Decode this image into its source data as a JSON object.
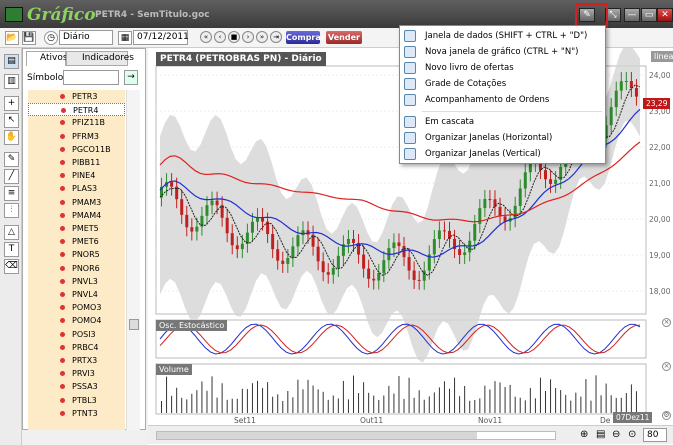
{
  "window": {
    "app_name": "Gráfico",
    "doc_title": "PETR4 - SemTitulo.goc"
  },
  "window_buttons": [
    "—",
    "▭",
    "✕"
  ],
  "toolbar": {
    "period": "Diário",
    "date": "07/12/2011",
    "buy_label": "Comprar",
    "sell_label": "Vender",
    "nav": [
      "«",
      "‹",
      "■",
      "›",
      "»",
      "⇥"
    ]
  },
  "panel": {
    "tabs": [
      "Ativos",
      "Indicadores"
    ],
    "symbol_label": "Símbolo",
    "symbol_value": "",
    "go_icon": "→",
    "assets": [
      "PETR3",
      "PETR4",
      "PFIZ11B",
      "PFRM3",
      "PGCO11B",
      "PIBB11",
      "PINE4",
      "PLAS3",
      "PMAM3",
      "PMAM4",
      "PMET5",
      "PMET6",
      "PNOR5",
      "PNOR6",
      "PNVL3",
      "PNVL4",
      "POMO3",
      "POMO4",
      "POSI3",
      "PRBC4",
      "PRTX3",
      "PRVI3",
      "PSSA3",
      "PTBL3",
      "PTNT3"
    ],
    "selected": "PETR4"
  },
  "chart": {
    "title": "PETR4 (PETROBRAS  PN) - Diário",
    "scale": "linear",
    "price_tag": "23,29",
    "y_labels": [
      "24,00",
      "23,00",
      "22,00",
      "21,00",
      "20,00",
      "19,00",
      "18,00"
    ],
    "x_labels": [
      "Set11",
      "Out11",
      "Nov11",
      "De"
    ],
    "date_tag": "07Dez11",
    "osc_label": "Osc. Estocástico",
    "volume_label": "Volume",
    "zoom": "80"
  },
  "menu": {
    "items": [
      {
        "label": "Janela de dados  (SHIFT + CTRL + \"D\")",
        "icon": "data-window-icon"
      },
      {
        "label": "Nova janela de gráfico  (CTRL + \"N\")",
        "icon": "new-chart-icon"
      },
      {
        "label": "Novo livro de ofertas",
        "icon": "order-book-icon"
      },
      {
        "label": "Grade de Cotações",
        "icon": "quotes-grid-icon"
      },
      {
        "label": "Acompanhamento de Ordens",
        "icon": "orders-icon"
      },
      {
        "label": "Em cascata",
        "icon": "cascade-icon"
      },
      {
        "label": "Organizar Janelas (Horizontal)",
        "icon": "tile-horizontal-icon"
      },
      {
        "label": "Organizar Janelas (Vertical)",
        "icon": "tile-vertical-icon"
      }
    ]
  },
  "colors": {
    "accent": "#d42020",
    "candle_up": "#2e8b2e",
    "candle_down": "#c02020",
    "ma_blue": "#2030d0",
    "ma_red": "#e02020",
    "bands": "#d4d4d4"
  }
}
